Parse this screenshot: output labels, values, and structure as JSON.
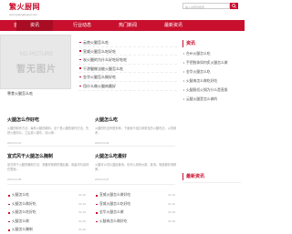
{
  "header": {
    "title": "繁火厨网",
    "url": "www.guangdeguai.com",
    "search_placeholder": "输入关键词搜索",
    "search_icon": "search-icon"
  },
  "nav": {
    "items": [
      {
        "label": "首页",
        "active": false
      },
      {
        "label": "资讯",
        "active": true
      },
      {
        "label": "行业动态",
        "active": false
      },
      {
        "label": "热门新闻",
        "active": false
      },
      {
        "label": "最新资讯",
        "active": false
      }
    ]
  },
  "slider": {
    "placeholder": "暂无图片",
    "placeholder_sub": "NO PICTURE",
    "caption": "寒食火腿怎么吃"
  },
  "top_list": [
    "云南火腿怎么吃",
    "宣威火腿怎么吃好吃",
    "炭火腿的为什么好吃好吃吃",
    "干渗腿做法能火腿怎么吃",
    "金华火腿怎么做好吃",
    "用什么做火腿肉最好"
  ],
  "side_top": {
    "title": "资讯",
    "items": [
      "台州火腿怎么吃",
      "手把肢体如何炙火腿怎么做",
      "金华火腿怎么吃",
      "火腿肉怎么做吃好吃",
      "火腿肠切火锅为什么是直角",
      "云腿火腿是怎么做的"
    ]
  },
  "cards": [
    {
      "title": "火腿怎么作好吃",
      "text": "火腿的制作方法，每有火腿的酱料，这个是火腿的制作方法，先把火腿切片，之后放入锅中，用火烤...",
      "meta": "2024-01-10"
    },
    {
      "title": "火腿怎么吃",
      "text": "火腿的吃法有很多种，下面就介绍几种常见的火腿吃法，以供参考...",
      "meta": "2024-01-09"
    },
    {
      "title": "宣式风干火腿怎么腌制",
      "text": "宣式风干火腿的腌制方法：准备好新鲜的猪后腿，用盐均匀涂抹在表面...",
      "meta": "2024-01-08"
    },
    {
      "title": "火腿怎么吃最好",
      "text": "火腿可以切片直接食用，也可以用来炒菜、煲汤，味道都非常鲜美...",
      "meta": "2024-01-07"
    }
  ],
  "side_bottom": {
    "title": "最新资讯",
    "items": []
  },
  "bottom_left": [
    {
      "text": "火腿怎么吃",
      "date": "01-10"
    },
    {
      "text": "火腿怎么做好吃",
      "date": "01-10"
    },
    {
      "text": "火腿怎么吃好吃",
      "date": "01-10"
    },
    {
      "text": "火腿怎么做",
      "date": "01-09"
    },
    {
      "text": "火腿怎么腌制",
      "date": "01-09"
    }
  ],
  "bottom_right": [
    {
      "text": "宣威火腿怎么做好吃",
      "date": "01-10"
    },
    {
      "text": "宣威火腿怎么吃好吃",
      "date": "01-10"
    },
    {
      "text": "金华火腿怎么做",
      "date": "01-09"
    },
    {
      "text": "火腿肉怎么做好吃",
      "date": "01-09"
    }
  ],
  "colors": {
    "brand": "#c8102e",
    "nav_active": "#a80d24"
  }
}
